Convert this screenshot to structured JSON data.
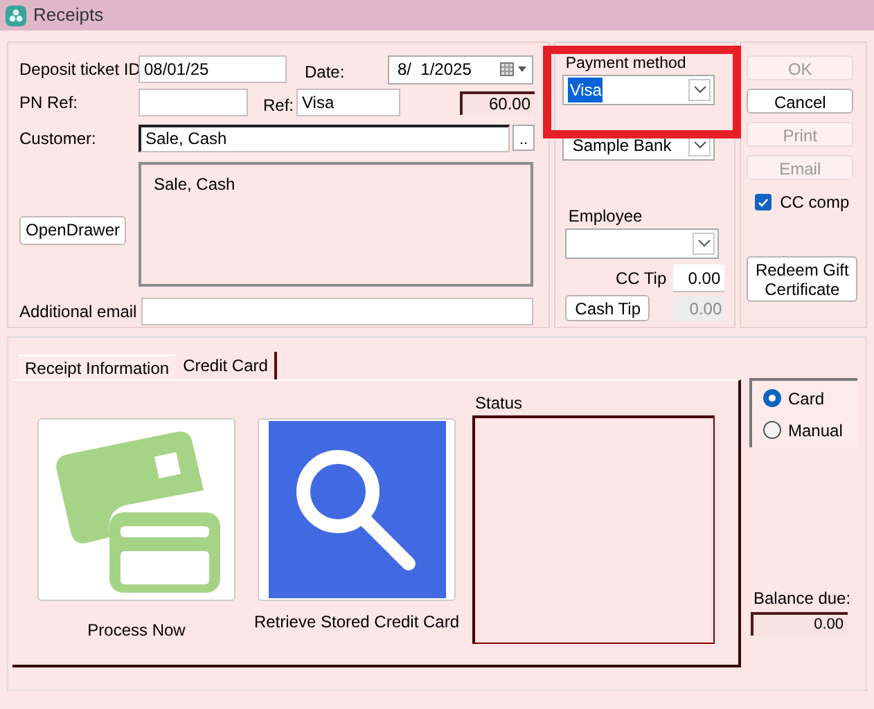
{
  "window": {
    "title": "Receipts"
  },
  "details": {
    "deposit_ticket_id": {
      "label": "Deposit ticket ID",
      "value": "08/01/25"
    },
    "date": {
      "label": "Date:",
      "value": "8/  1/2025"
    },
    "pn_ref": {
      "label": "PN Ref:"
    },
    "ref": {
      "label": "Ref:",
      "value": "Visa"
    },
    "amount": "60.00",
    "customer": {
      "label": "Customer:",
      "value": "Sale, Cash",
      "browse": ".."
    },
    "address": "Sale, Cash",
    "open_drawer": "OpenDrawer",
    "additional_email": {
      "label": "Additional email"
    }
  },
  "payment": {
    "payment_method": {
      "label": "Payment method",
      "value": "Visa",
      "text_selected": true,
      "highlighted": true
    },
    "bank_account": {
      "value": "Sample Bank"
    },
    "employee": {
      "label": "Employee"
    },
    "cc_tip": {
      "label": "CC Tip",
      "value": "0.00"
    },
    "cash_tip": {
      "button": "Cash Tip",
      "value": "0.00"
    }
  },
  "actions": [
    {
      "label": "OK",
      "disabled": true
    },
    {
      "label": "Cancel",
      "disabled": false
    },
    {
      "label": "Print",
      "disabled": true
    },
    {
      "label": "Email",
      "disabled": true
    }
  ],
  "cc_comp": {
    "label": "CC comp",
    "checked": true
  },
  "redeem": "Redeem Gift Certificate",
  "tabs": [
    {
      "label": "Receipt Information",
      "selected": false
    },
    {
      "label": "Credit Card",
      "selected": true
    }
  ],
  "tiles": [
    {
      "kind": "card",
      "label": "Process Now"
    },
    {
      "kind": "search",
      "label": "Retrieve Stored Credit Card"
    }
  ],
  "status": {
    "label": "Status"
  },
  "entry_mode": [
    {
      "label": "Card",
      "selected": true
    },
    {
      "label": "Manual",
      "selected": false
    }
  ],
  "balance_due": {
    "label": "Balance due:",
    "value": "0.00"
  }
}
